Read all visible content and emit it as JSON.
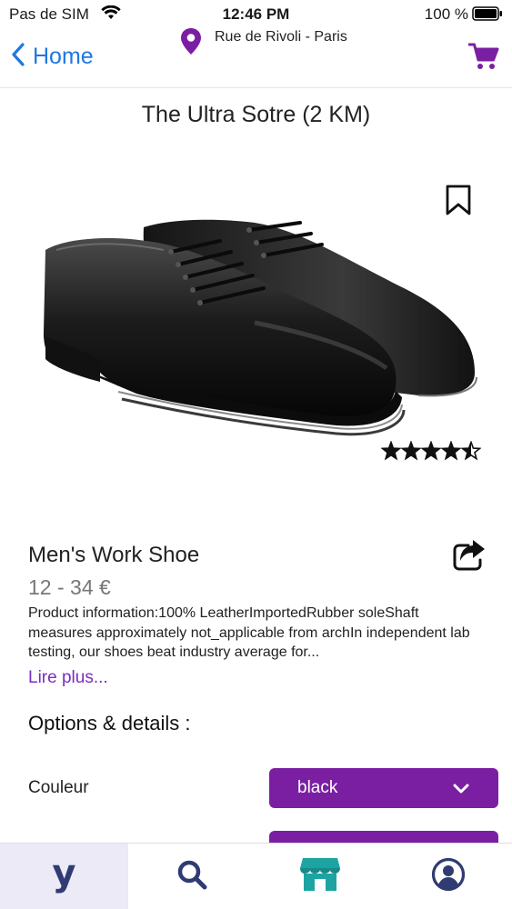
{
  "status_bar": {
    "carrier": "Pas de SIM",
    "time": "12:46 PM",
    "battery": "100 %"
  },
  "nav": {
    "back_label": "Home",
    "location": "Rue de Rivoli - Paris",
    "icons": [
      "chevron-left-icon",
      "map-pin-icon",
      "cart-icon"
    ],
    "accent_color": "#7b1fa2",
    "link_color": "#1e78e0"
  },
  "store": {
    "title": "The Ultra Sotre  (2 KM)"
  },
  "product": {
    "name": "Men's Work Shoe",
    "price": "12 - 34 €",
    "description": "Product information:100% LeatherImportedRubber soleShaft measures approximately not_applicable from archIn independent lab testing, our shoes beat industry average for...",
    "read_more": "Lire plus...",
    "rating": 4.5,
    "rating_max": 5
  },
  "options": {
    "title": "Options & details :",
    "color_label": "Couleur",
    "color_value": "black"
  },
  "tab_bar": {
    "home_logo": "y",
    "tabs": [
      "home-logo-icon",
      "search-icon",
      "store-icon",
      "profile-icon"
    ],
    "active_index": 0
  }
}
